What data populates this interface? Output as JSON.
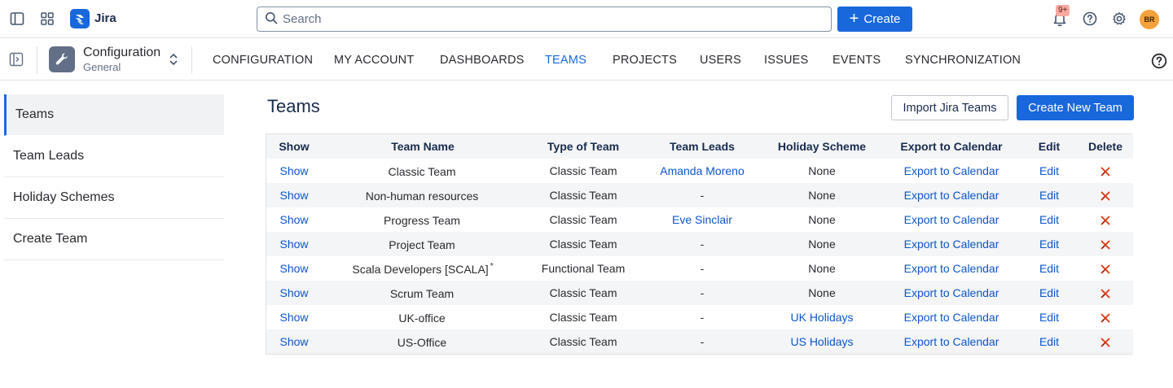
{
  "app": {
    "name": "Jira",
    "search_placeholder": "Search",
    "create_label": "Create",
    "notification_badge": "9+",
    "avatar_initials": "BR"
  },
  "context": {
    "title": "Configuration",
    "subtitle": "General"
  },
  "nav": {
    "items": [
      {
        "label": "CONFIGURATION",
        "active": false
      },
      {
        "label": "MY ACCOUNT",
        "active": false
      },
      {
        "label": "DASHBOARDS",
        "active": false
      },
      {
        "label": "TEAMS",
        "active": true
      },
      {
        "label": "PROJECTS",
        "active": false
      },
      {
        "label": "USERS",
        "active": false
      },
      {
        "label": "ISSUES",
        "active": false
      },
      {
        "label": "EVENTS",
        "active": false
      },
      {
        "label": "SYNCHRONIZATION",
        "active": false
      }
    ]
  },
  "sidebar": {
    "items": [
      {
        "label": "Teams",
        "active": true
      },
      {
        "label": "Team Leads",
        "active": false
      },
      {
        "label": "Holiday Schemes",
        "active": false
      },
      {
        "label": "Create Team",
        "active": false
      }
    ]
  },
  "main": {
    "title": "Teams",
    "import_label": "Import Jira Teams",
    "create_team_label": "Create New Team"
  },
  "table": {
    "headers": [
      "Show",
      "Team Name",
      "Type of Team",
      "Team Leads",
      "Holiday Scheme",
      "Export to Calendar",
      "Edit",
      "Delete"
    ],
    "rows": [
      {
        "show": "Show",
        "name": "Classic Team",
        "marker": "",
        "type": "Classic Team",
        "leads": "Amanda Moreno",
        "leads_link": true,
        "holiday": "None",
        "holiday_link": false,
        "export": "Export to Calendar",
        "edit": "Edit"
      },
      {
        "show": "Show",
        "name": "Non-human resources",
        "marker": "",
        "type": "Classic Team",
        "leads": "-",
        "leads_link": false,
        "holiday": "None",
        "holiday_link": false,
        "export": "Export to Calendar",
        "edit": "Edit"
      },
      {
        "show": "Show",
        "name": "Progress Team",
        "marker": "",
        "type": "Classic Team",
        "leads": "Eve Sinclair",
        "leads_link": true,
        "holiday": "None",
        "holiday_link": false,
        "export": "Export to Calendar",
        "edit": "Edit"
      },
      {
        "show": "Show",
        "name": "Project Team",
        "marker": "",
        "type": "Classic Team",
        "leads": "-",
        "leads_link": false,
        "holiday": "None",
        "holiday_link": false,
        "export": "Export to Calendar",
        "edit": "Edit"
      },
      {
        "show": "Show",
        "name": "Scala Developers [SCALA]",
        "marker": "*",
        "type": "Functional Team",
        "leads": "-",
        "leads_link": false,
        "holiday": "None",
        "holiday_link": false,
        "export": "Export to Calendar",
        "edit": "Edit"
      },
      {
        "show": "Show",
        "name": "Scrum Team",
        "marker": "",
        "type": "Classic Team",
        "leads": "-",
        "leads_link": false,
        "holiday": "None",
        "holiday_link": false,
        "export": "Export to Calendar",
        "edit": "Edit"
      },
      {
        "show": "Show",
        "name": "UK-office",
        "marker": "",
        "type": "Classic Team",
        "leads": "-",
        "leads_link": false,
        "holiday": "UK Holidays",
        "holiday_link": true,
        "export": "Export to Calendar",
        "edit": "Edit"
      },
      {
        "show": "Show",
        "name": "US-Office",
        "marker": "",
        "type": "Classic Team",
        "leads": "-",
        "leads_link": false,
        "holiday": "US Holidays",
        "holiday_link": true,
        "export": "Export to Calendar",
        "edit": "Edit"
      }
    ]
  },
  "colors": {
    "brand": "#1868db",
    "link": "#0c55c9",
    "delete": "#de350b",
    "row_alt": "#f4f5f7",
    "avatar": "#f5a23d"
  },
  "icons": {
    "topbar": [
      "sidebar-toggle-icon",
      "app-switcher-icon",
      "jira-logo-icon",
      "search-icon",
      "bell-icon",
      "help-icon",
      "gear-icon"
    ],
    "context": [
      "wrench-icon",
      "chevron-updown-icon"
    ],
    "row_delete": "delete-x-icon"
  }
}
